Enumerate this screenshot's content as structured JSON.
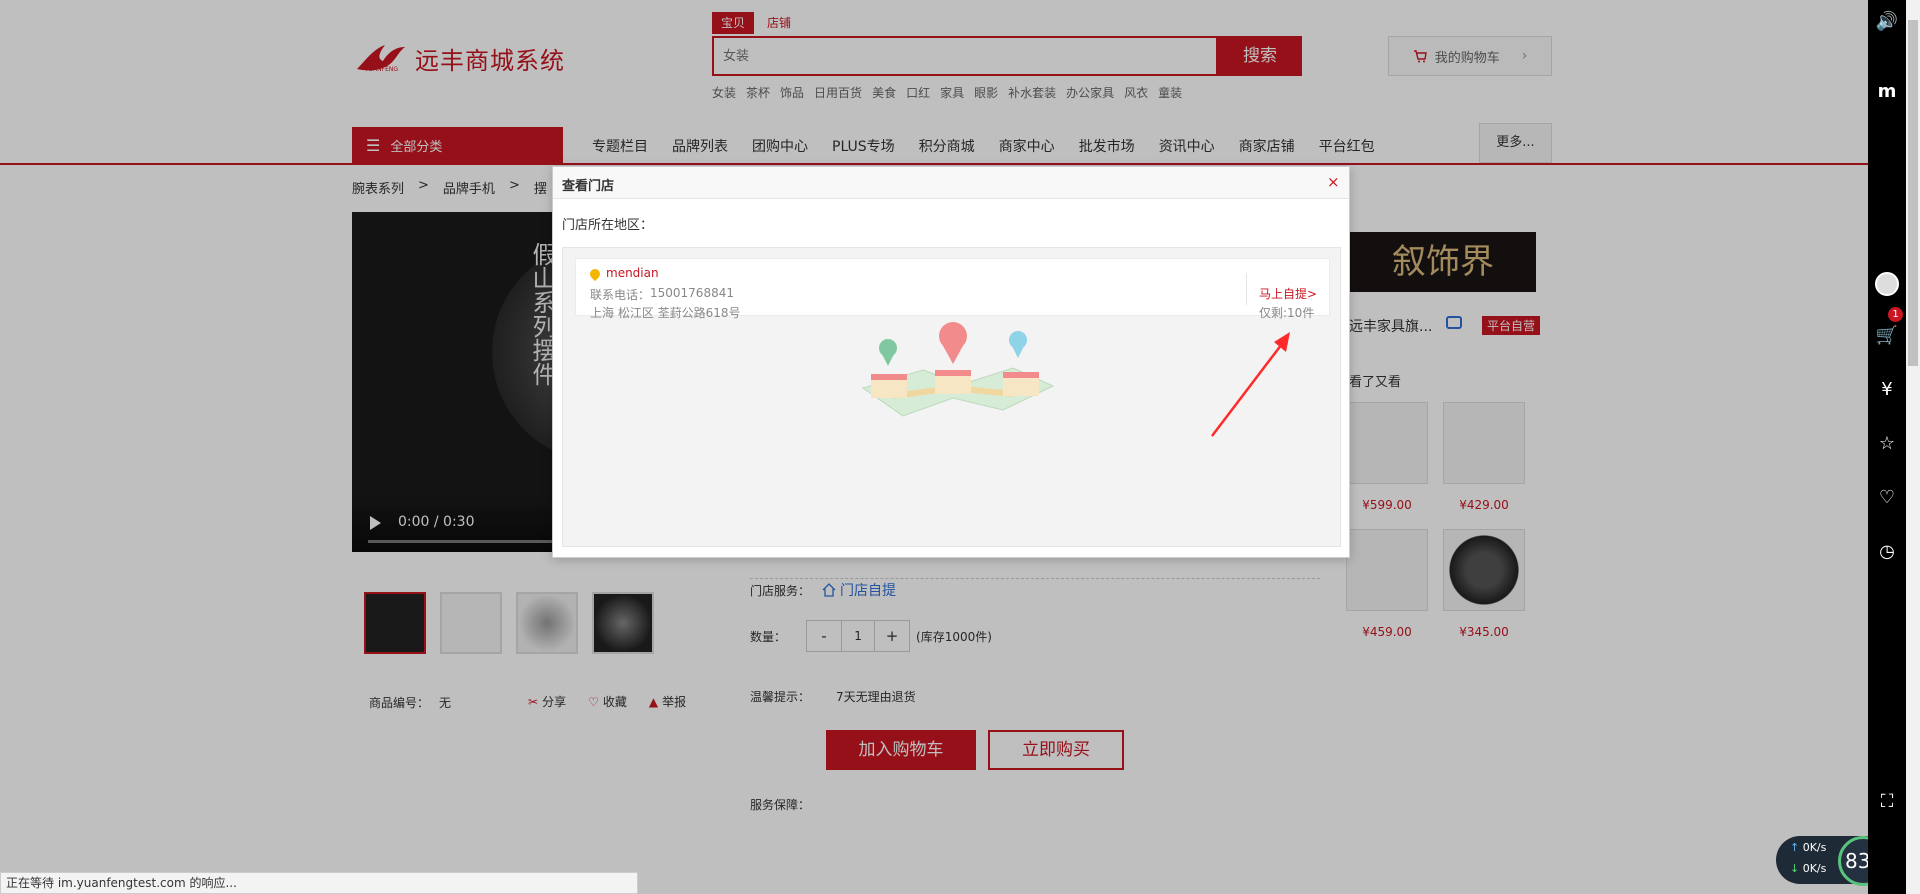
{
  "header": {
    "logo_text": "远丰商城系统",
    "logo_sub": "YUANFENG",
    "search_tabs": [
      "宝贝",
      "店铺"
    ],
    "search_placeholder": "女装",
    "search_button": "搜索",
    "hot_words": [
      "女装",
      "茶杯",
      "饰品",
      "日用百货",
      "美食",
      "口红",
      "家具",
      "眼影",
      "补水套装",
      "办公家具",
      "风衣",
      "童装"
    ],
    "cart_label": "我的购物车"
  },
  "nav": {
    "all_categories": "全部分类",
    "items": [
      "专题栏目",
      "品牌列表",
      "团购中心",
      "PLUS专场",
      "积分商城",
      "商家中心",
      "批发市场",
      "资讯中心",
      "商家店铺",
      "平台红包"
    ],
    "more": "更多..."
  },
  "breadcrumb": [
    "腕表系列",
    ">",
    "品牌手机",
    ">",
    "摆"
  ],
  "product": {
    "video_title": "假山系列摆件",
    "video_time": "0:00 / 0:30",
    "id_label": "商品编号：",
    "id_value": "无",
    "share": "分享",
    "favorite": "收藏",
    "report": "举报",
    "store_service_label": "门店服务：",
    "store_service_link": "门店自提",
    "qty_label": "数量：",
    "qty_minus": "-",
    "qty_value": "1",
    "qty_plus": "+",
    "stock": "(库存1000件)",
    "tip_label": "温馨提示：",
    "tip_value": "7天无理由退货",
    "add_to_cart": "加入购物车",
    "buy_now": "立即购买",
    "guarantee_label": "服务保障："
  },
  "shop": {
    "logo_text": "叙饰界",
    "name": "远丰家具旗...",
    "badge": "平台自营",
    "seen_label": "看了又看",
    "recommend_prices": [
      "¥599.00",
      "¥429.00",
      "¥459.00",
      "¥345.00"
    ]
  },
  "modal": {
    "title": "查看门店",
    "close": "×",
    "region_label": "门店所在地区：",
    "store": {
      "name": "mendian",
      "phone_label": "联系电话：",
      "phone": "15001768841",
      "address": "上海 松江区 荃葑公路618号",
      "pickup": "马上自提>",
      "remaining": "仅剩:10件"
    }
  },
  "status_bar": "正在等待 im.yuanfengtest.com 的响应...",
  "sidebar": {
    "cart_badge": "1"
  },
  "net_monitor": {
    "up": "0K/s",
    "down": "0K/s",
    "percent": "83",
    "percent_unit": "%"
  },
  "colors": {
    "brand_red": "#c81623",
    "link_blue": "#2f6fd6",
    "pin_yellow": "#f5b400"
  }
}
